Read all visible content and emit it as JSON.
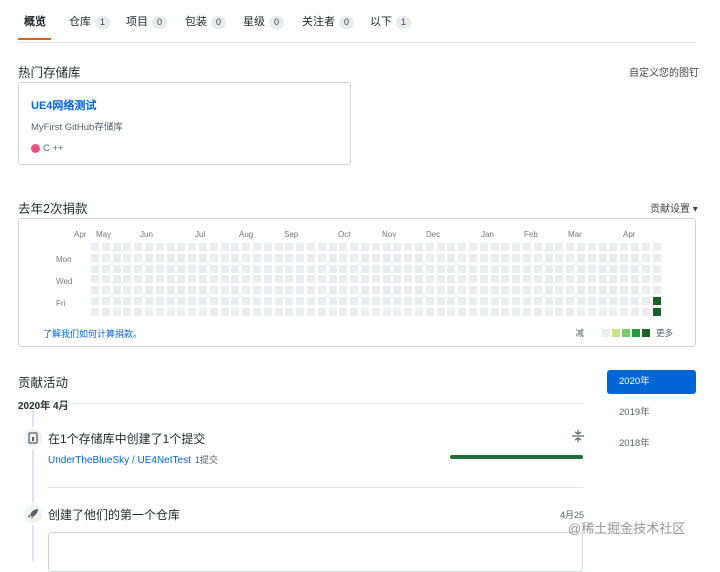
{
  "tabs": [
    {
      "label": "概览",
      "count": ""
    },
    {
      "label": "仓库",
      "count": "1"
    },
    {
      "label": "项目",
      "count": "0"
    },
    {
      "label": "包装",
      "count": "0"
    },
    {
      "label": "星级",
      "count": "0"
    },
    {
      "label": "关注者",
      "count": "0"
    },
    {
      "label": "以下",
      "count": "1"
    }
  ],
  "popular": {
    "title": "热门存储库",
    "customize_link": "自定义您的图钉",
    "repo": {
      "name": "UE4网络测试",
      "description": "MyFirst GitHub存储库",
      "language": "C ++",
      "language_color": "#f34b7d"
    }
  },
  "contributions": {
    "title": "去年2次捐款",
    "settings_link": "贡献设置 ▾",
    "months": [
      "Apr",
      "May",
      "Jun",
      "Jul",
      "Aug",
      "Sep",
      "Oct",
      "Nov",
      "Dec",
      "Jan",
      "Feb",
      "Mar",
      "Apr"
    ],
    "days": [
      "Mon",
      "Wed",
      "Fri"
    ],
    "learn_link": "了解我们如何计算捐款。",
    "legend_less": "减",
    "legend_more": "更多",
    "legend_colors": [
      "#ebedf0",
      "#c6e48b",
      "#7bc96f",
      "#239a3b",
      "#196127"
    ],
    "empty_color": "#ebedf0",
    "active_color": "#196127"
  },
  "activity": {
    "title": "贡献活动",
    "years": [
      "2020年",
      "2019年",
      "2018年"
    ],
    "month_heading": "2020年 4月",
    "item1": {
      "title": "在1个存储库中创建了1个提交",
      "repo": "UnderTheBlueSky / UE4NetTest",
      "commits": "1提交",
      "collapse_icon": "collapse-icon"
    },
    "item2": {
      "title": "创建了他们的第一个仓库",
      "date": "4月25"
    }
  },
  "watermark": "@稀土掘金技术社区"
}
